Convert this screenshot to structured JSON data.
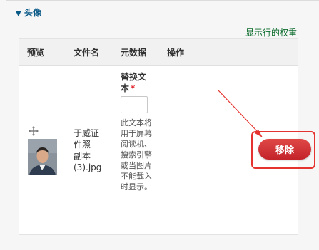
{
  "section": {
    "title": "头像",
    "weights_link": "显示行的权重"
  },
  "table": {
    "headers": {
      "preview": "预览",
      "filename": "文件名",
      "metadata": "元数据",
      "actions": "操作"
    },
    "row": {
      "filename": "于威证件照 - 副本 (3).jpg",
      "alt_label": "替换文本",
      "required_mark": "*",
      "alt_value": "",
      "alt_description": "此文本将用于屏幕阅读机、搜索引擎或当图片不能载入时显示。",
      "remove_label": "移除"
    }
  },
  "colors": {
    "link": "#0a5a88",
    "weights_link": "#0a6b2b",
    "button": "#d0323a",
    "highlight": "#e53430"
  }
}
